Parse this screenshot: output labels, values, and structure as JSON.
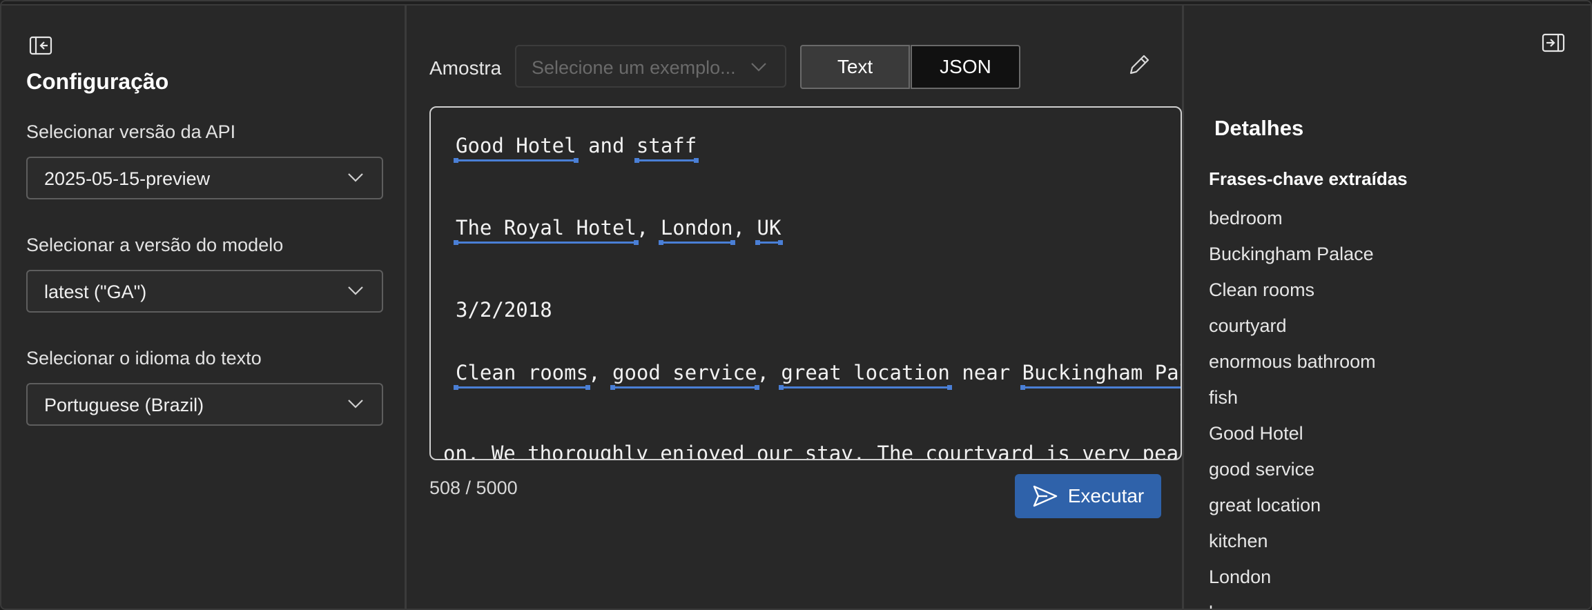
{
  "config": {
    "title": "Configuração",
    "api_version": {
      "label": "Selecionar versão da API",
      "value": "2025-05-15-preview"
    },
    "model_version": {
      "label": "Selecionar a versão do modelo",
      "value": "latest (\"GA\")"
    },
    "language": {
      "label": "Selecionar o idioma do texto",
      "value": "Portuguese (Brazil)"
    }
  },
  "input": {
    "sample_label": "Amostra",
    "sample_placeholder": "Selecione um exemplo...",
    "tab_text": "Text",
    "tab_json": "JSON",
    "counter": "508 / 5000",
    "run_label": "Executar",
    "lines": {
      "l1_a": "Good Hotel",
      "l1_b": " and ",
      "l1_c": "staff",
      "l2_a": "The Royal Hotel",
      "l2_b": ", ",
      "l2_c": "London",
      "l2_d": ", ",
      "l2_e": "UK",
      "l3": "3/2/2018",
      "l4_a": "Clean rooms",
      "l4_b": ", ",
      "l4_c": "good service",
      "l4_d": ", ",
      "l4_e": "great location",
      "l4_f": " near ",
      "l4_g": "Buckingham Pal",
      "l5": "on. We thoroughly enjoyed our stay. The courtyard is very peac"
    }
  },
  "details": {
    "title": "Detalhes",
    "key_phrases_title": "Frases-chave extraídas",
    "key_phrases": [
      "bedroom",
      "Buckingham Palace",
      "Clean rooms",
      "courtyard",
      "enormous bathroom",
      "fish",
      "Good Hotel",
      "good service",
      "great location",
      "kitchen",
      "London",
      "l"
    ]
  },
  "icons": {
    "collapse": "panel-collapse-left-icon",
    "expand": "panel-expand-right-icon",
    "edit": "pencil-icon",
    "send": "send-icon",
    "chevron": "chevron-down-icon"
  },
  "colors": {
    "accent": "#2f62aa",
    "underline": "#4a7fd6",
    "background": "#282828"
  }
}
